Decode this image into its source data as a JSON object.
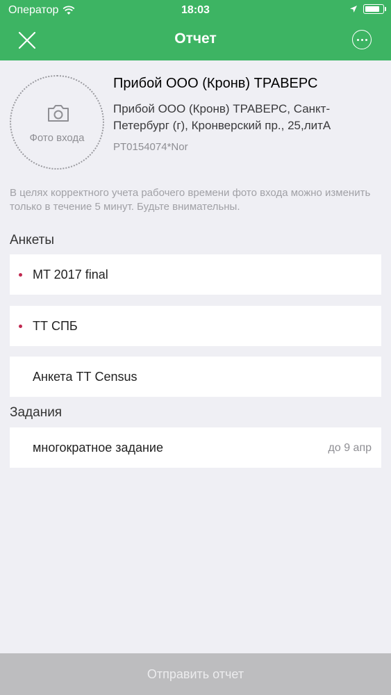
{
  "status_bar": {
    "carrier": "Оператор",
    "time": "18:03",
    "battery_level": 0.85
  },
  "nav": {
    "title": "Отчет",
    "left_icon": "close-icon",
    "right_icon": "more-icon"
  },
  "outlet": {
    "photo_label": "Фото входа",
    "name": "Прибой ООО (Кронв) ТРАВЕРС",
    "address": "Прибой ООО (Кронв) ТРАВЕРС, Санкт-Петербург (г), Кронверский пр., 25,литА",
    "code": "PT0154074*Nor"
  },
  "warning": "В целях корректного учета рабочего времени фото входа можно изменить только в течение 5 минут. Будьте внимательны.",
  "surveys": {
    "title": "Анкеты",
    "items": [
      {
        "label": "MT 2017 final",
        "required": true
      },
      {
        "label": "ТТ СПБ",
        "required": true
      },
      {
        "label": "Анкета ТТ Census",
        "required": false
      }
    ]
  },
  "tasks": {
    "title": "Задания",
    "items": [
      {
        "label": "многократное задание",
        "due": "до 9 апр"
      }
    ]
  },
  "submit_label": "Отправить отчет",
  "colors": {
    "accent": "#3db463",
    "required_dot": "#c0284f",
    "submit_disabled": "#bdbdbf"
  }
}
